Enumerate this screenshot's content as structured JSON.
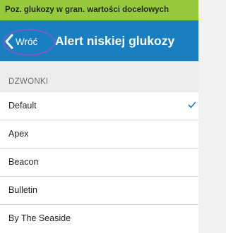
{
  "banner": {
    "text": "Poz. glukozy w gran. wartości docelowych"
  },
  "nav": {
    "back_label": "Wróć",
    "title": "Alert niskiej glukozy"
  },
  "section": {
    "label": "DZWONKI"
  },
  "ringtones": [
    {
      "label": "Default",
      "selected": true
    },
    {
      "label": "Apex",
      "selected": false
    },
    {
      "label": "Beacon",
      "selected": false
    },
    {
      "label": "Bulletin",
      "selected": false
    },
    {
      "label": "By The Seaside",
      "selected": false
    }
  ],
  "colors": {
    "banner": "#97c93d",
    "nav": "#1a7fc1",
    "highlight": "#7b5cc4",
    "check": "#1a7fc1"
  }
}
